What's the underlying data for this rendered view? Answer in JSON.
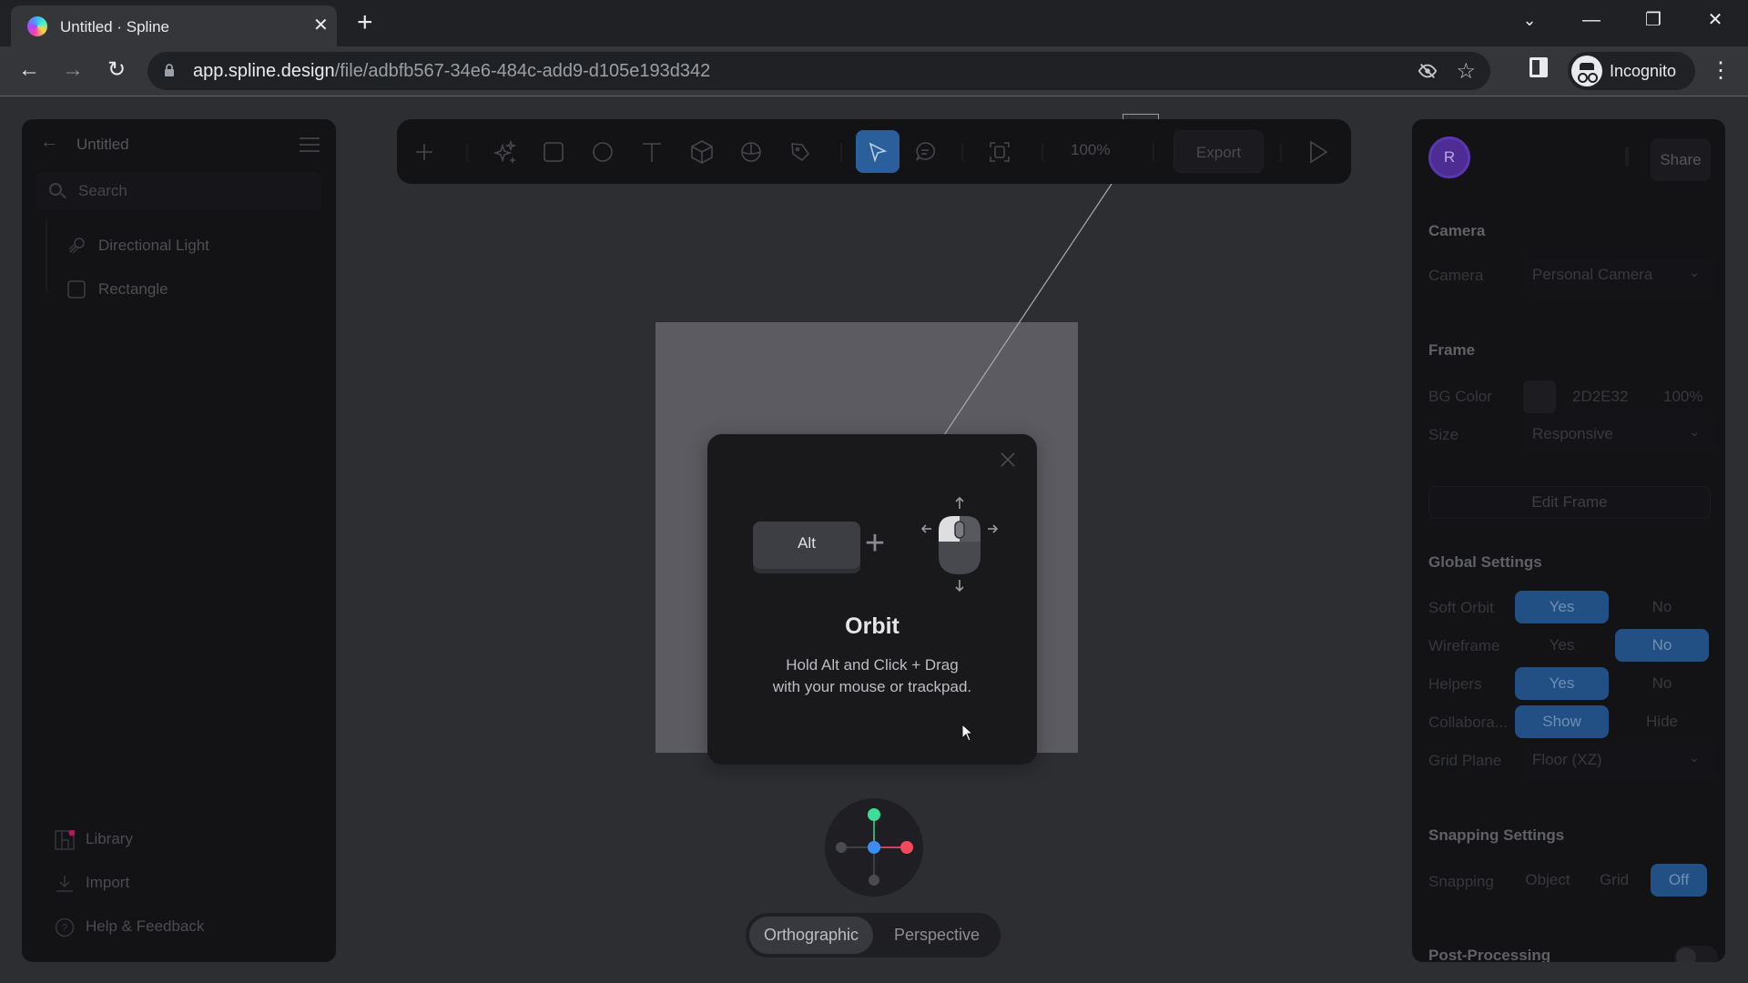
{
  "browser": {
    "tab_title": "Untitled · Spline",
    "tab_close_glyph": "✕",
    "new_tab_glyph": "+",
    "url_host": "app.spline.design",
    "url_path": "/file/adbfb567-34e6-484c-add9-d105e193d342",
    "profile_label": "Incognito",
    "window_controls": {
      "tab_search": "⌄",
      "minimize": "—",
      "restore": "❐",
      "close": "✕"
    },
    "nav": {
      "back": "←",
      "forward": "→",
      "reload": "↻"
    },
    "icons": {
      "eye_off": "👁",
      "star": "☆",
      "menu": "⋮"
    }
  },
  "left_panel": {
    "title": "Untitled",
    "back_glyph": "←",
    "search_placeholder": "Search",
    "layers": [
      {
        "name": "Directional Light",
        "icon": "directional-light-icon"
      },
      {
        "name": "Rectangle",
        "icon": "rectangle-icon"
      }
    ],
    "bottom_items": [
      {
        "label": "Library",
        "icon": "library-icon",
        "badge_color": "#c2185b"
      },
      {
        "label": "Import",
        "icon": "import-icon"
      },
      {
        "label": "Help & Feedback",
        "icon": "help-icon"
      }
    ]
  },
  "toolbar": {
    "tools": [
      {
        "name": "add",
        "icon": "plus-icon"
      },
      {
        "name": "ai-generate",
        "icon": "sparkle-icon"
      },
      {
        "name": "rectangle",
        "icon": "square-icon"
      },
      {
        "name": "ellipse",
        "icon": "circle-icon"
      },
      {
        "name": "text",
        "icon": "text-icon"
      },
      {
        "name": "3d-shape",
        "icon": "cube-icon"
      },
      {
        "name": "sphere",
        "icon": "sphere-icon"
      },
      {
        "name": "pen",
        "icon": "pen-icon"
      },
      {
        "name": "select",
        "icon": "cursor-icon",
        "active": true
      },
      {
        "name": "comment",
        "icon": "comment-icon"
      },
      {
        "name": "frame",
        "icon": "frame-icon"
      }
    ],
    "zoom": "100%",
    "export_label": "Export",
    "play_icon": "play-icon",
    "accent_color": "#2b5f9b"
  },
  "dialog": {
    "key_label": "Alt",
    "plus": "+",
    "title": "Orbit",
    "description_line1": "Hold Alt and Click + Drag",
    "description_line2": "with your mouse or trackpad."
  },
  "viewport": {
    "gizmo_colors": {
      "y": "#3ddc97",
      "x": "#f2495c",
      "z": "#3a8ef6",
      "neg": "#4a4b50"
    },
    "view_modes": [
      "Orthographic",
      "Perspective"
    ],
    "active_view": "Orthographic"
  },
  "right_panel": {
    "avatar_initial": "R",
    "share_label": "Share",
    "camera": {
      "header": "Camera",
      "label": "Camera",
      "value": "Personal Camera"
    },
    "frame": {
      "header": "Frame",
      "bg_label": "BG Color",
      "bg_hex": "2D2E32",
      "bg_opacity": "100%",
      "size_label": "Size",
      "size_value": "Responsive",
      "edit_label": "Edit Frame"
    },
    "global": {
      "header": "Global Settings",
      "rows": [
        {
          "label": "Soft Orbit",
          "options": [
            "Yes",
            "No"
          ],
          "selected": "Yes"
        },
        {
          "label": "Wireframe",
          "options": [
            "Yes",
            "No"
          ],
          "selected": "No"
        },
        {
          "label": "Helpers",
          "options": [
            "Yes",
            "No"
          ],
          "selected": "Yes"
        },
        {
          "label": "Collabora...",
          "options": [
            "Show",
            "Hide"
          ],
          "selected": "Show"
        }
      ],
      "grid_label": "Grid Plane",
      "grid_value": "Floor (XZ)"
    },
    "snapping": {
      "header": "Snapping Settings",
      "label": "Snapping",
      "options": [
        "Object",
        "Grid",
        "Off"
      ],
      "selected": "Off"
    },
    "post_processing": {
      "header": "Post-Processing",
      "enabled": false
    }
  }
}
